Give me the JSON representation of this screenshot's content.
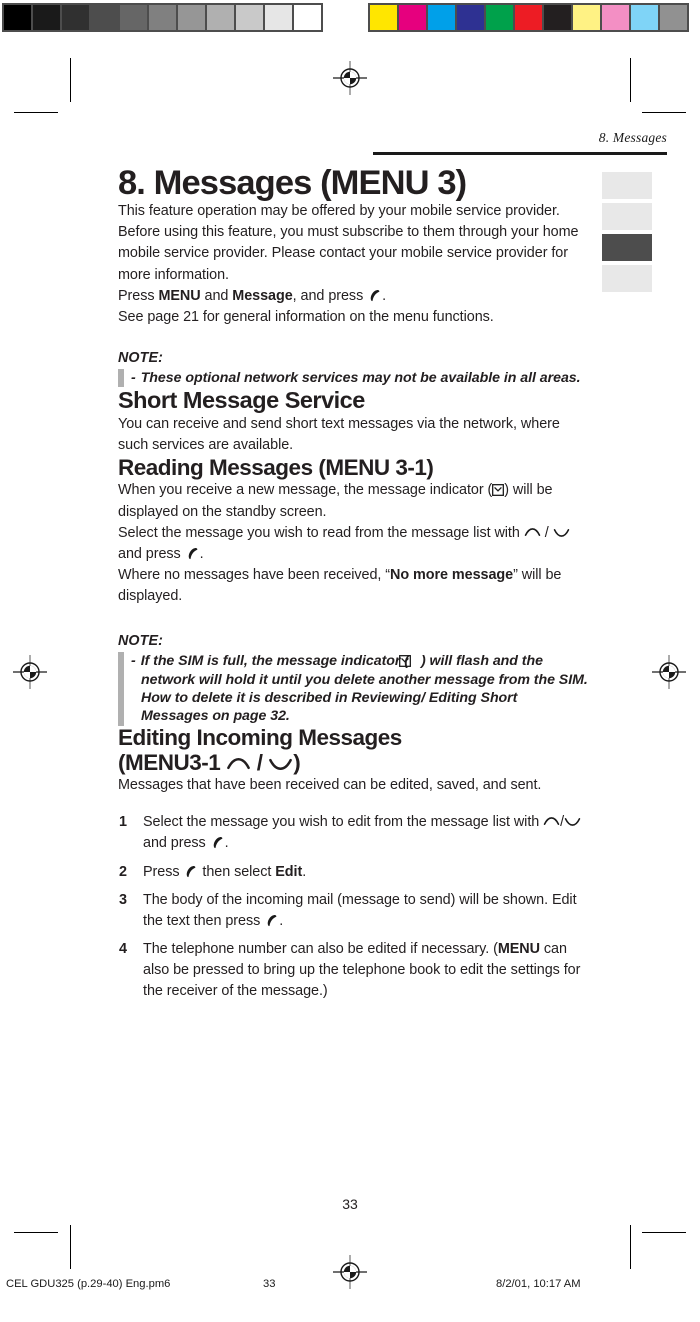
{
  "calibration": {
    "grayscale_label": "grayscale-step-wedge",
    "grayscale": [
      "#000000",
      "#1a1a1a",
      "#303030",
      "#4d4d4d",
      "#666666",
      "#808080",
      "#969696",
      "#b0b0b0",
      "#c9c9c9",
      "#e6e6e6",
      "#ffffff"
    ],
    "color_label": "color-control-patches",
    "colors": [
      "#ffe600",
      "#e6007e",
      "#00a0e9",
      "#2e3192",
      "#00a14b",
      "#ed1c24",
      "#231f20",
      "#fff284",
      "#f38fc4",
      "#7fd4f7",
      "#919191"
    ]
  },
  "running_head": "8. Messages",
  "title": "8. Messages (MENU 3)",
  "tabs": [
    {
      "name": "tab-marker-1",
      "active": false
    },
    {
      "name": "tab-marker-2",
      "active": false
    },
    {
      "name": "tab-marker-3",
      "active": true
    },
    {
      "name": "tab-marker-4",
      "active": false
    }
  ],
  "intro": "This feature operation may be offered by your mobile service provider. Before using this feature, you must subscribe to them through your home mobile service provider. Please contact your mobile service provider for more information.",
  "press_line": {
    "pre": "Press ",
    "menu": "MENU",
    "mid": " and ",
    "message": "Message",
    "post": ", and press ",
    "end": "."
  },
  "see_page_line": "See page 21 for general information on the menu functions.",
  "note_label": "NOTE:",
  "note_dash": "-",
  "note_1": "These optional network services may not be available in all areas.",
  "sms": {
    "heading": "Short Message Service",
    "body": "You can receive and send short text messages via the network, where such services are available."
  },
  "reading": {
    "heading": "Reading Messages (MENU 3-1)",
    "line1_a": "When you receive a new message, the message indicator (",
    "line1_b": ") will be displayed on the standby screen.",
    "line2_a": "Select the message you wish to read from the message list with ",
    "line2_slash": " / ",
    "line2_b": " and press ",
    "line2_end": ".",
    "line3_a": "Where no messages have been received, “",
    "line3_bold": "No more message",
    "line3_b": "” will be displayed."
  },
  "note_2": {
    "a": "If the SIM is full, the message indicator (",
    "b": ") will flash and the network will hold it until you delete another message from the SIM. How to delete it is described in Reviewing/ Editing Short Messages on page 32."
  },
  "editing": {
    "heading_line1": "Editing Incoming Messages",
    "heading_line2_a": "(MENU3-1 ",
    "heading_line2_slash": " / ",
    "heading_line2_b": ")",
    "body": "Messages that have been received can be edited, saved, and sent.",
    "steps": [
      {
        "num": "1",
        "a": "Select the message you wish to edit from the message list with ",
        "slash": "/",
        "b": " and press ",
        "end": "."
      },
      {
        "num": "2",
        "a": "Press ",
        "b": " then select ",
        "bold": "Edit",
        "end": "."
      },
      {
        "num": "3",
        "a": "The body of the incoming mail (message to send) will be shown. Edit the text then press ",
        "end": "."
      },
      {
        "num": "4",
        "a": "The telephone number can also be edited if necessary. (",
        "bold": "MENU",
        "b": " can also be pressed to bring up the telephone book to edit the settings for the receiver of the message.)"
      }
    ]
  },
  "page_number": "33",
  "slug": {
    "file": "CEL GDU325 (p.29-40) Eng.pm6",
    "page": "33",
    "date": "8/2/01, 10:17 AM"
  }
}
